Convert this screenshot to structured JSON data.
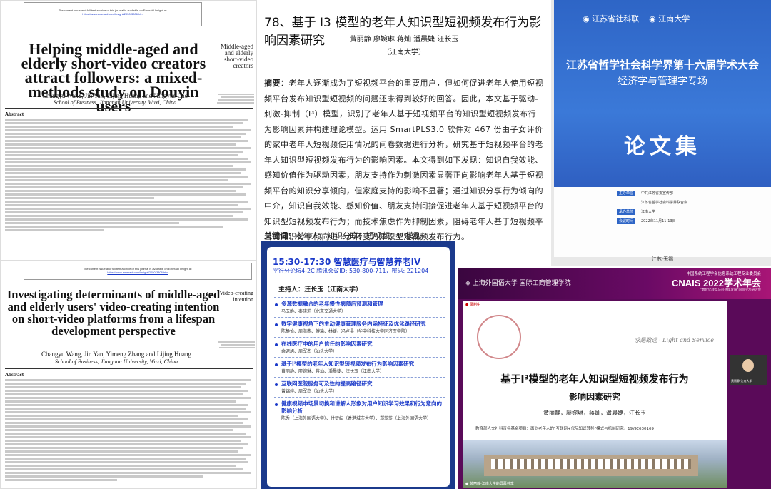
{
  "paperA": {
    "notice": "The current issue and full text archive of this journal is available on Emerald Insight at:",
    "url": "https://www.emerald.com/insight/2050-3806.htm",
    "title": "Helping middle-aged and elderly short-video creators attract followers: a mixed-methods study on Douyin users",
    "side": "Middle-aged and elderly short-video creators",
    "authors": "Changyu Wang, Jin Yan, Lijing Huang and Ningyue Cao",
    "affiliation": "School of Business, Jiangnan University, Wuxi, China",
    "abstract_heading": "Abstract"
  },
  "paperB": {
    "title": "78、基于 I3 模型的老年人知识型短视频发布行为影响因素研究",
    "authors": "黄丽静  廖婉琳  蒋灿  潘晨婕  汪长玉",
    "affiliation": "（江南大学）",
    "abstract_label": "摘要：",
    "abstract": "老年人逐渐成为了短视频平台的重要用户，但如何促进老年人使用短视频平台发布知识型短视频的问题还未得到较好的回答。因此，本文基于驱动-刺激-抑制（I³）模型，识别了老年人基于短视频平台的知识型短视频发布行为影响因素并构建理论模型。运用 SmartPLS3.0 软件对 467 份由子女评价的家中老年人短视频使用情况的问卷数据进行分析，研究基于短视频平台的老年人知识型短视频发布行为的影响因素。本文得到如下发现：知识自我效能、感知价值作为驱动因素，朋友支持作为刺激因素显著正向影响老年人基于短视频平台的知识分享倾向，但家庭支持的影响不显著；通过知识分享行为倾向的中介，知识自我效能、感知价值、朋友支持间接促进老年人基于短视频平台的知识型短视频发布行为；而技术焦虑作为抑制因素，阻碍老年人基于短视频平台的知识分享倾向进一步转变为知识型短视频发布行为。",
    "keywords_label": "关键词：",
    "keywords": "老年人；知识分享；短视频；I³ 模型"
  },
  "coverC": {
    "logo1": "江苏省社科联",
    "logo2": "江南大学",
    "title1": "江苏省哲学社会科学界第十六届学术大会",
    "title2": "经济学与管理学专场",
    "main": "论文集",
    "rows": [
      {
        "tag": "主办单位",
        "val": "中共江苏省委宣传部"
      },
      {
        "tag": "",
        "val": "江苏省哲学社会科学界联合会"
      },
      {
        "tag": "承办单位",
        "val": "江南大学"
      },
      {
        "tag": "会议时间",
        "val": "2022年11月11-13日"
      }
    ],
    "city": "江苏·无锡"
  },
  "paperD": {
    "notice": "The current issue and full text archive of this journal is available on Emerald Insight at:",
    "url": "https://www.emerald.com/insight/2050-3806.htm",
    "title": "Investigating determinants of middle-aged and elderly users' video-creating intention on short-video platforms from a lifespan development perspective",
    "side": "Video-creating intention",
    "authors": "Changyu Wang, Jin Yan, Yimeng Zhang and Lijing Huang",
    "affiliation": "School of Business, Jiangnan University, Wuxi, China",
    "abstract_heading": "Abstract"
  },
  "programE": {
    "time": "15:30-17:30",
    "session": "智慧医疗与智慧养老IV",
    "sub": "平行分论坛4-2C   腾讯会议ID: 530-800-711，密码: 221204",
    "host": "主持人：汪长玉（江南大学）",
    "items": [
      {
        "title": "多源数据融合的老年慢性病预后预测和管理",
        "authors": "马玉静、秦晓莉（北京交通大学）"
      },
      {
        "title": "数字健康视角下的主动健康管理服务内涵特征及优化路径研究",
        "authors": "陈静怡、周海燕、傅瑜、林媛、冯卢昊（华中科技大学同济医学院）"
      },
      {
        "title": "在线医疗中的用户信任的影响因素研究",
        "authors": "余迟旭、周军杰（汕头大学）"
      },
      {
        "title": "基于I³模型的老年人知识型短视频发布行为影响因素研究",
        "authors": "黄丽静、廖婉琳、蒋灿、潘晨婕、汪长玉（江南大学）"
      },
      {
        "title": "互联网医院服务可及性的提高路径研究",
        "authors": "曾锦婷、周军杰（汕头大学）"
      },
      {
        "title": "健康视频中场景切换和讲解人形象对用户知识学习效果和行为意向的影响分析",
        "authors": "陈秀（上海外国语大学）、付梦纭（香港城市大学）、郑莎莎（上海外国语大学）"
      }
    ]
  },
  "slideF": {
    "university": "上海外国语大学 国际工商管理学院",
    "conf1": "中国系统工程学会信息系统工程专业委员会",
    "conf2": "CNAIS 2022学术年会",
    "conf3": "\"数智化转型与可持续发展\"国际学术研讨会",
    "rec": "● 录制中",
    "calli": "求是致远 · Light and Service",
    "title1": "基于I³模型的老年人知识型短视频发布行为",
    "title2": "影响因素研究",
    "authors": "黄丽静，廖婉琳，蒋灿，潘晨婕，汪长玉",
    "project": "教育部人文社科青年基金项目：面向老年人的\"互联网+代际知识转移\"模式与机制研究，19YJC630169",
    "speaker": "黄丽静-江南大学",
    "footer": "● 黄丽静-江南大学的屏幕共享"
  },
  "colors": {
    "blue": "#1a39c9",
    "coverBlue": "#2e65c6",
    "slidePurple": "#5a0a59"
  }
}
